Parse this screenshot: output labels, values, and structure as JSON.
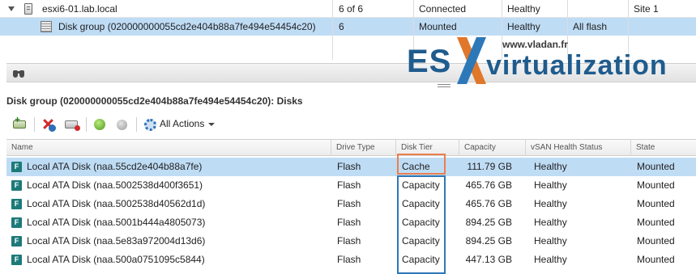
{
  "host_table": {
    "rows": [
      {
        "name": "esxi6-01.lab.local",
        "disks": "6 of 6",
        "state": "Connected",
        "health": "Healthy",
        "type": "",
        "fault_domain": "Site 1"
      },
      {
        "name": "Disk group (020000000055cd2e404b88a7fe494e54454c20)",
        "disks": "6",
        "state": "Mounted",
        "health": "Healthy",
        "type": "All flash",
        "fault_domain": ""
      }
    ]
  },
  "watermark": {
    "url": "www.vladan.fr",
    "brand_es": "ES",
    "brand_virt": "virtualization",
    "colors": {
      "blue": "#1f5c8e",
      "x_orange": "#e0772a",
      "x_blue": "#2d78b8"
    }
  },
  "section_title": "Disk group (020000000055cd2e404b88a7fe494e54454c20): Disks",
  "toolbar": {
    "icons": [
      "add-disk-icon",
      "remove-disk-icon",
      "remove-icon",
      "green-status-icon",
      "gray-status-icon",
      "gear-icon"
    ],
    "all_actions_label": "All Actions"
  },
  "disks_grid": {
    "columns": [
      "Name",
      "Drive Type",
      "Disk Tier",
      "Capacity",
      "vSAN Health Status",
      "State"
    ],
    "rows": [
      {
        "name": "Local ATA Disk (naa.55cd2e404b88a7fe)",
        "drive_type": "Flash",
        "tier": "Cache",
        "capacity": "111.79 GB",
        "health": "Healthy",
        "state": "Mounted"
      },
      {
        "name": "Local ATA Disk (naa.5002538d400f3651)",
        "drive_type": "Flash",
        "tier": "Capacity",
        "capacity": "465.76 GB",
        "health": "Healthy",
        "state": "Mounted"
      },
      {
        "name": "Local ATA Disk (naa.5002538d40562d1d)",
        "drive_type": "Flash",
        "tier": "Capacity",
        "capacity": "465.76 GB",
        "health": "Healthy",
        "state": "Mounted"
      },
      {
        "name": "Local ATA Disk (naa.5001b444a4805073)",
        "drive_type": "Flash",
        "tier": "Capacity",
        "capacity": "894.25 GB",
        "health": "Healthy",
        "state": "Mounted"
      },
      {
        "name": "Local ATA Disk (naa.5e83a972004d13d6)",
        "drive_type": "Flash",
        "tier": "Capacity",
        "capacity": "894.25 GB",
        "health": "Healthy",
        "state": "Mounted"
      },
      {
        "name": "Local ATA Disk (naa.500a0751095c5844)",
        "drive_type": "Flash",
        "tier": "Capacity",
        "capacity": "447.13 GB",
        "health": "Healthy",
        "state": "Mounted"
      }
    ],
    "disk_icon_letter": "F",
    "selected_row": 0
  },
  "highlight_colors": {
    "cache_box": "#ea7f4e",
    "capacity_box": "#2d78b8",
    "selection": "#bfdcf5"
  }
}
